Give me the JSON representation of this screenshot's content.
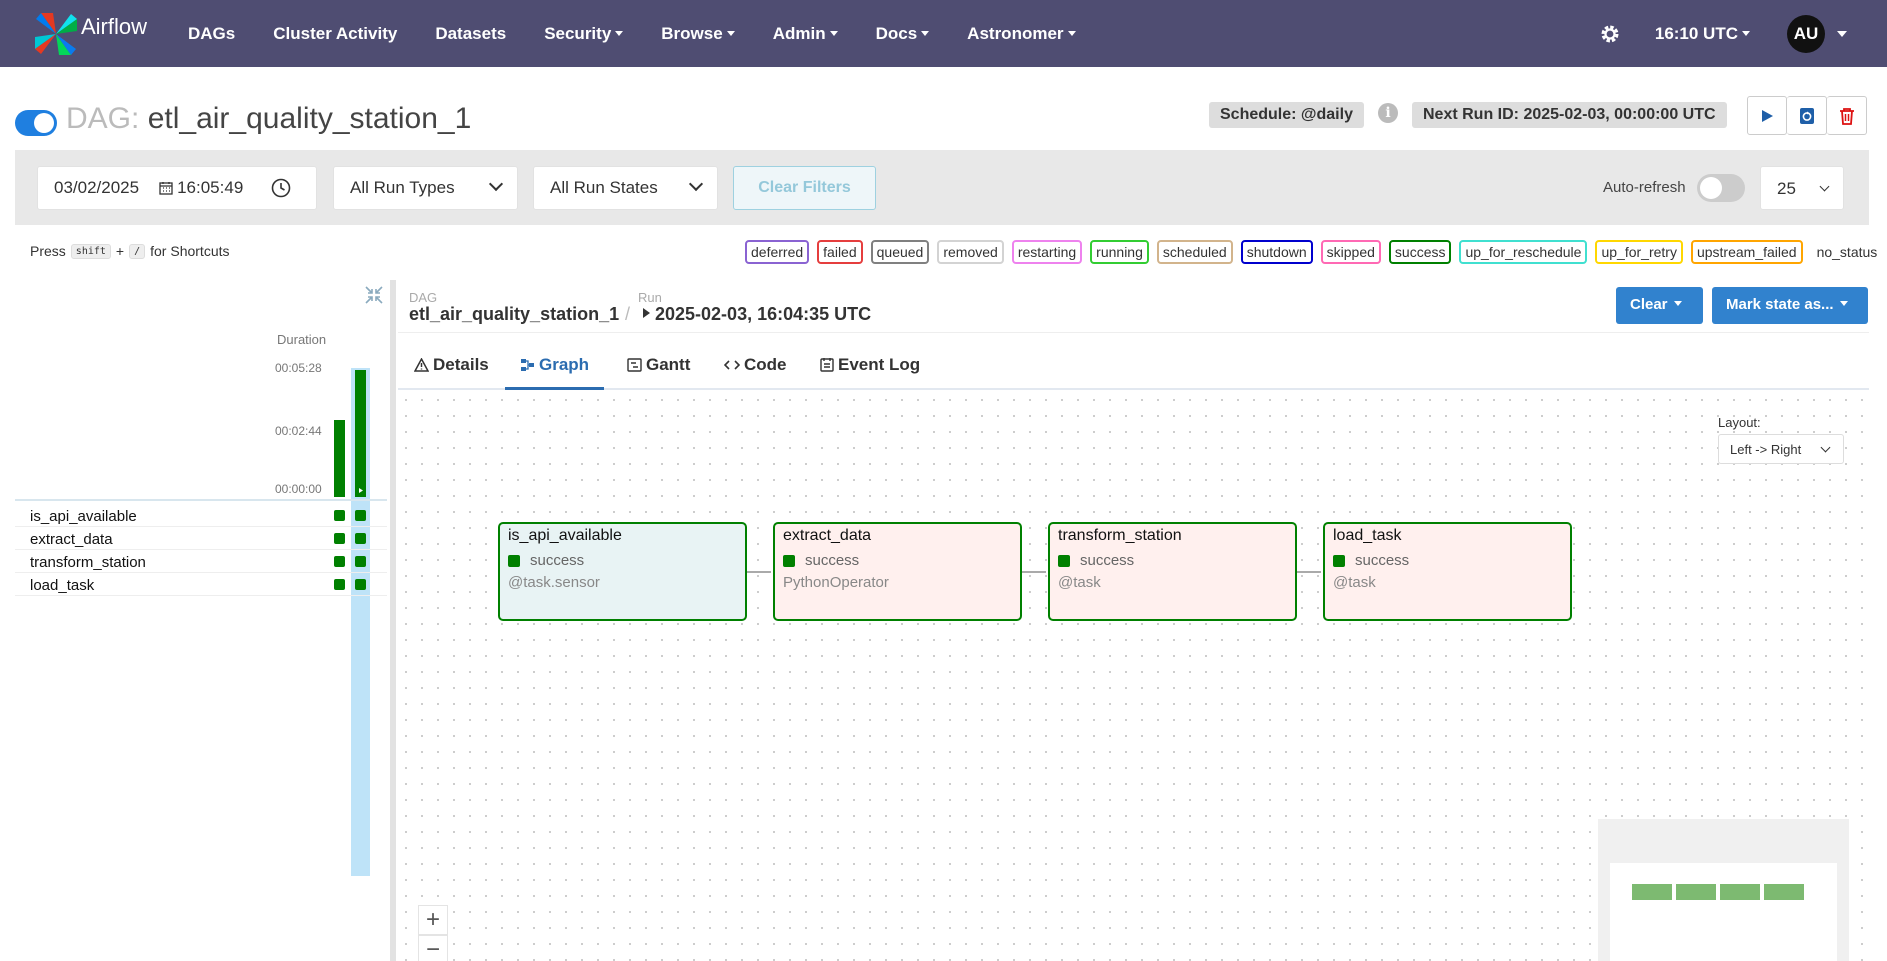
{
  "navbar": {
    "brand": "Airflow",
    "items": [
      {
        "label": "DAGs",
        "dropdown": false
      },
      {
        "label": "Cluster Activity",
        "dropdown": false
      },
      {
        "label": "Datasets",
        "dropdown": false
      },
      {
        "label": "Security",
        "dropdown": true
      },
      {
        "label": "Browse",
        "dropdown": true
      },
      {
        "label": "Admin",
        "dropdown": true
      },
      {
        "label": "Docs",
        "dropdown": true
      },
      {
        "label": "Astronomer",
        "dropdown": true
      }
    ],
    "time": "16:10 UTC",
    "avatar": "AU",
    "bg_color": "#4f4d72"
  },
  "dag": {
    "prefix": "DAG:",
    "id": "etl_air_quality_station_1",
    "schedule": "Schedule: @daily",
    "info_icon": "i",
    "next_run": "Next Run ID: 2025-02-03, 00:00:00 UTC",
    "paused": false
  },
  "filters": {
    "date": "03/02/2025",
    "time": "16:05:49",
    "run_types": "All Run Types",
    "run_states": "All Run States",
    "clear": "Clear Filters",
    "auto_refresh": "Auto-refresh",
    "auto_refresh_on": false,
    "page_size": "25"
  },
  "shortcut": {
    "press": "Press",
    "key1": "shift",
    "plus": "+",
    "key2": "/",
    "suffix": "for Shortcuts"
  },
  "legend": [
    {
      "label": "deferred",
      "color": "#8a63d2"
    },
    {
      "label": "failed",
      "color": "#e53e3e"
    },
    {
      "label": "queued",
      "color": "#808080"
    },
    {
      "label": "removed",
      "color": "#d3d3d3"
    },
    {
      "label": "restarting",
      "color": "#ee82ee"
    },
    {
      "label": "running",
      "color": "#32cd32"
    },
    {
      "label": "scheduled",
      "color": "#d2b48c"
    },
    {
      "label": "shutdown",
      "color": "#0000cd"
    },
    {
      "label": "skipped",
      "color": "#ff69b4"
    },
    {
      "label": "success",
      "color": "#008000"
    },
    {
      "label": "up_for_reschedule",
      "color": "#40e0d0"
    },
    {
      "label": "up_for_retry",
      "color": "#ffd700"
    },
    {
      "label": "upstream_failed",
      "color": "#ffa500"
    }
  ],
  "legend_plain": "no_status",
  "grid": {
    "duration_label": "Duration",
    "ticks": [
      "00:05:28",
      "00:02:44",
      "00:00:00"
    ],
    "runs": [
      {
        "duration_fraction": 0.6,
        "selected": false
      },
      {
        "duration_fraction": 0.995,
        "selected": true
      }
    ],
    "tasks": [
      {
        "name": "is_api_available"
      },
      {
        "name": "extract_data"
      },
      {
        "name": "transform_station"
      },
      {
        "name": "load_task"
      }
    ]
  },
  "details": {
    "dag_label": "DAG",
    "dag_value": "etl_air_quality_station_1",
    "sep": "/",
    "run_label": "Run",
    "run_value": "2025-02-03, 16:04:35 UTC",
    "clear_btn": "Clear",
    "mark_btn": "Mark state as...",
    "tabs": [
      "Details",
      "Graph",
      "Gantt",
      "Code",
      "Event Log"
    ],
    "active_tab": "Graph"
  },
  "graph": {
    "layout_label": "Layout:",
    "layout_value": "Left -> Right",
    "nodes": [
      {
        "name": "is_api_available",
        "state": "success",
        "operator": "@task.sensor"
      },
      {
        "name": "extract_data",
        "state": "success",
        "operator": "PythonOperator"
      },
      {
        "name": "transform_station",
        "state": "success",
        "operator": "@task"
      },
      {
        "name": "load_task",
        "state": "success",
        "operator": "@task"
      }
    ],
    "zoom_in": "+",
    "zoom_out": "−"
  },
  "colors": {
    "success": "#008000",
    "accent_blue": "#3182ce"
  }
}
